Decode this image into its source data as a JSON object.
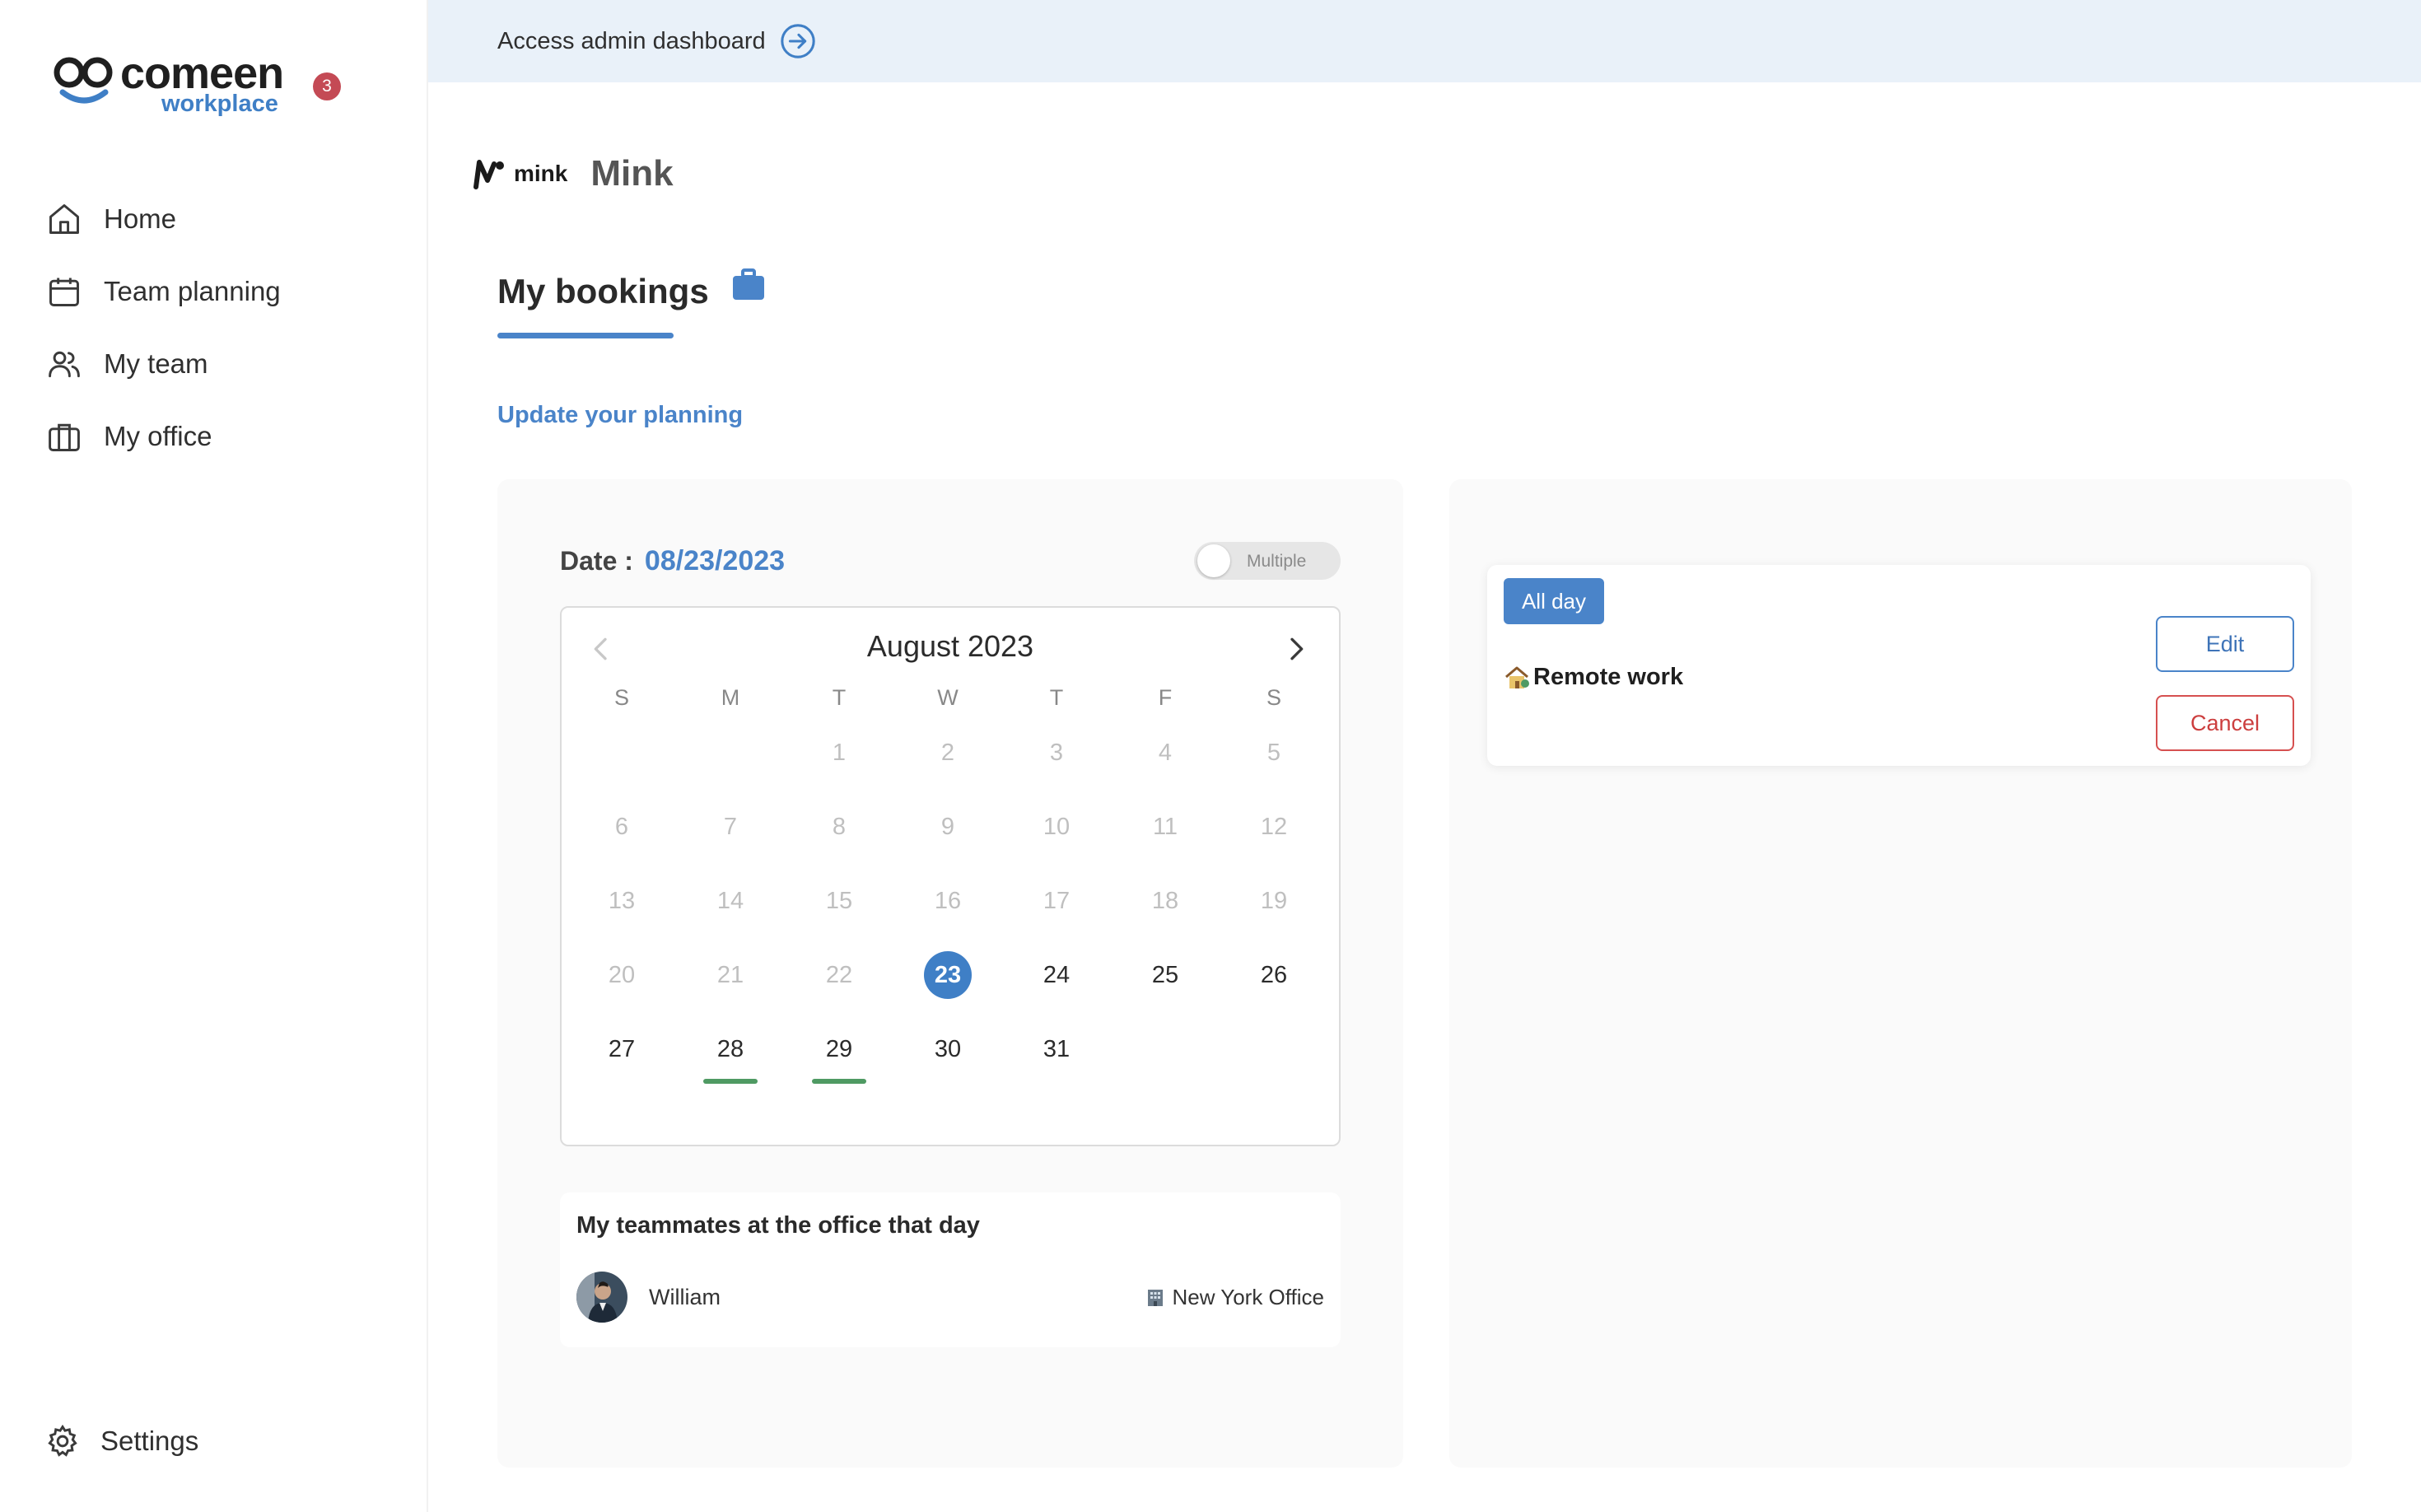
{
  "brand": {
    "name": "comeen",
    "sub": "workplace",
    "notification_count": "3"
  },
  "sidebar": {
    "items": [
      {
        "label": "Home",
        "icon": "home-icon"
      },
      {
        "label": "Team planning",
        "icon": "calendar-icon"
      },
      {
        "label": "My team",
        "icon": "users-icon"
      },
      {
        "label": "My office",
        "icon": "briefcase-icon"
      }
    ],
    "settings_label": "Settings"
  },
  "banner": {
    "text": "Access admin dashboard"
  },
  "org": {
    "logo_text": "mink",
    "name": "Mink"
  },
  "page": {
    "title": "My bookings",
    "update_link": "Update your planning"
  },
  "date_selector": {
    "label": "Date :",
    "value": "08/23/2023",
    "toggle_label": "Multiple",
    "toggle_on": false
  },
  "calendar": {
    "month_label": "August 2023",
    "weekdays": [
      "S",
      "M",
      "T",
      "W",
      "T",
      "F",
      "S"
    ],
    "selected_day": 23,
    "first_weekday_index": 2,
    "days_in_month": 31,
    "marked_days": [
      28,
      29
    ],
    "accent_color": "#3f7fc6",
    "mark_color": "#4f9a63"
  },
  "teammates": {
    "title": "My teammates at the office that day",
    "list": [
      {
        "name": "William",
        "office": "New York Office"
      }
    ]
  },
  "booking": {
    "badge": "All day",
    "type": "Remote work",
    "edit_label": "Edit",
    "cancel_label": "Cancel"
  }
}
